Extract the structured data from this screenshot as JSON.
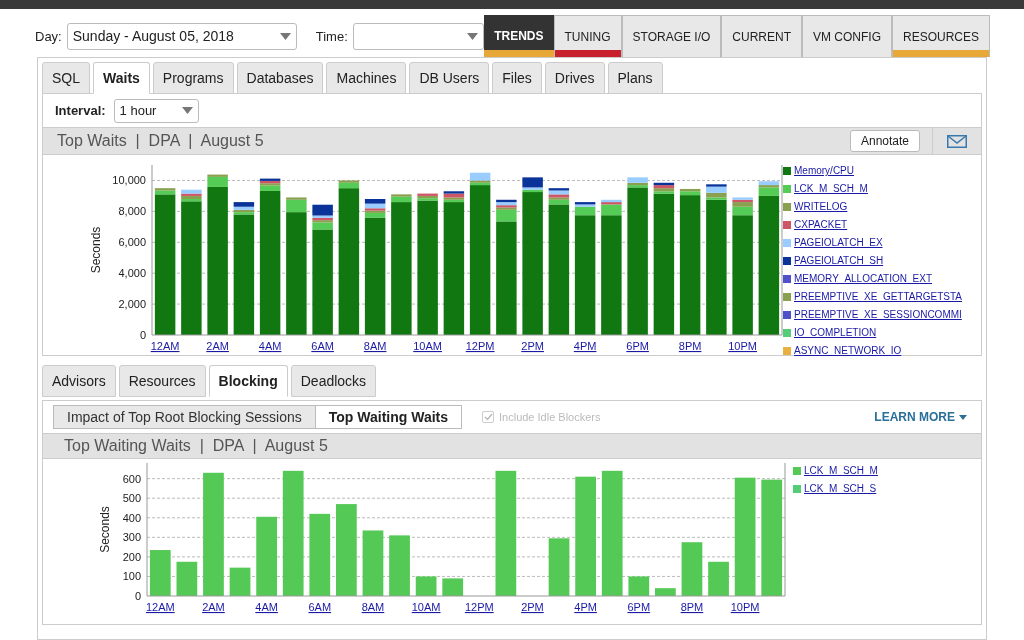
{
  "filters": {
    "day_label": "Day:",
    "day_value": "Sunday - August 05, 2018",
    "time_label": "Time:"
  },
  "nav_tabs": [
    {
      "label": "TRENDS",
      "selected": true,
      "color": "#e8a838"
    },
    {
      "label": "TUNING",
      "selected": false,
      "color": "#c8202c"
    },
    {
      "label": "STORAGE I/O",
      "selected": false
    },
    {
      "label": "CURRENT",
      "selected": false
    },
    {
      "label": "VM CONFIG",
      "selected": false
    },
    {
      "label": "RESOURCES",
      "selected": false,
      "color": "#e8a838"
    }
  ],
  "tabs": [
    {
      "label": "SQL",
      "selected": false
    },
    {
      "label": "Waits",
      "selected": true
    },
    {
      "label": "Programs",
      "selected": false
    },
    {
      "label": "Databases",
      "selected": false
    },
    {
      "label": "Machines",
      "selected": false
    },
    {
      "label": "DB Users",
      "selected": false
    },
    {
      "label": "Files",
      "selected": false
    },
    {
      "label": "Drives",
      "selected": false
    },
    {
      "label": "Plans",
      "selected": false
    }
  ],
  "waits_panel": {
    "interval_label": "Interval:",
    "interval_value": "1 hour",
    "header": "Top Waits  |  DPA  |  August 5",
    "annotate_button": "Annotate",
    "chart_data": {
      "type": "bar",
      "stacked": true,
      "grid": true,
      "ylabel": "Seconds",
      "ylim": [
        0,
        11000
      ],
      "yticks": [
        {
          "value": 0,
          "label": "0"
        },
        {
          "value": 2000,
          "label": "2,000"
        },
        {
          "value": 4000,
          "label": "4,000"
        },
        {
          "value": 6000,
          "label": "6,000"
        },
        {
          "value": 8000,
          "label": "8,000"
        },
        {
          "value": 10000,
          "label": "10,000"
        }
      ],
      "categories": [
        "12AM",
        null,
        "2AM",
        null,
        "4AM",
        null,
        "6AM",
        null,
        "8AM",
        null,
        "10AM",
        null,
        "12PM",
        null,
        "2PM",
        null,
        "4PM",
        null,
        "6PM",
        null,
        "8PM",
        null,
        "10PM",
        null
      ],
      "series": [
        {
          "name": "Memory/CPU",
          "color": "#117711",
          "values": [
            9100,
            8650,
            9580,
            7800,
            9320,
            7950,
            6830,
            9500,
            7600,
            8600,
            8700,
            8600,
            9700,
            7350,
            9250,
            8450,
            7750,
            7750,
            9550,
            9150,
            9050,
            8750,
            7750,
            9000
          ]
        },
        {
          "name": "LCK_M_SCH_M",
          "color": "#55cc55",
          "values": [
            250,
            150,
            650,
            150,
            350,
            800,
            450,
            350,
            300,
            350,
            150,
            150,
            150,
            750,
            150,
            300,
            550,
            700,
            150,
            150,
            250,
            150,
            550,
            550
          ]
        },
        {
          "name": "WRITELOG",
          "color": "#88a050",
          "values": [
            150,
            200,
            150,
            150,
            150,
            150,
            150,
            150,
            150,
            150,
            150,
            150,
            150,
            150,
            0,
            150,
            0,
            0,
            150,
            200,
            150,
            300,
            300,
            150
          ]
        },
        {
          "name": "CXPACKET",
          "color": "#cc5566",
          "values": [
            0,
            150,
            0,
            0,
            150,
            0,
            150,
            0,
            150,
            0,
            150,
            250,
            0,
            150,
            0,
            200,
            0,
            150,
            0,
            200,
            0,
            0,
            150,
            0
          ]
        },
        {
          "name": "PAGEIOLATCH_EX",
          "color": "#99ccff",
          "values": [
            0,
            250,
            0,
            200,
            0,
            0,
            150,
            0,
            300,
            0,
            0,
            0,
            500,
            200,
            150,
            250,
            150,
            150,
            350,
            0,
            0,
            400,
            150,
            250
          ]
        },
        {
          "name": "PAGEIOLATCH_SH",
          "color": "#0a3399",
          "values": [
            0,
            0,
            0,
            300,
            150,
            0,
            700,
            0,
            300,
            0,
            0,
            150,
            0,
            150,
            650,
            150,
            150,
            0,
            0,
            150,
            0,
            150,
            0,
            0
          ]
        },
        {
          "name": "MEMORY_ALLOCATION_EXT",
          "color": "#5050c8",
          "values": [
            0,
            0,
            0,
            0,
            0,
            0,
            0,
            0,
            0,
            0,
            0,
            0,
            0,
            0,
            0,
            0,
            0,
            0,
            0,
            0,
            0,
            0,
            0,
            0
          ]
        },
        {
          "name": "PREEMPTIVE_XE_GETTARGETSTA",
          "color": "#88a050",
          "values": [
            0,
            0,
            0,
            0,
            0,
            0,
            0,
            0,
            0,
            0,
            0,
            0,
            0,
            0,
            0,
            0,
            0,
            0,
            0,
            0,
            0,
            0,
            0,
            0
          ]
        },
        {
          "name": "PREEMPTIVE_XE_SESSIONCOMMI",
          "color": "#5050c8",
          "values": [
            0,
            0,
            0,
            0,
            0,
            0,
            0,
            0,
            0,
            0,
            0,
            0,
            0,
            0,
            0,
            0,
            0,
            0,
            0,
            0,
            0,
            0,
            0,
            0
          ]
        },
        {
          "name": "IO_COMPLETION",
          "color": "#55cc77",
          "values": [
            0,
            0,
            0,
            0,
            0,
            0,
            0,
            0,
            0,
            0,
            0,
            0,
            0,
            0,
            0,
            0,
            0,
            0,
            0,
            0,
            0,
            0,
            0,
            0
          ]
        },
        {
          "name": "ASYNC_NETWORK_IO",
          "color": "#e8b040",
          "values": [
            0,
            0,
            0,
            0,
            0,
            0,
            0,
            0,
            0,
            0,
            0,
            0,
            0,
            0,
            0,
            0,
            0,
            0,
            0,
            0,
            0,
            0,
            0,
            0
          ]
        }
      ]
    }
  },
  "sub_tabs": [
    {
      "label": "Advisors",
      "selected": false
    },
    {
      "label": "Resources",
      "selected": false
    },
    {
      "label": "Blocking",
      "selected": true
    },
    {
      "label": "Deadlocks",
      "selected": false
    }
  ],
  "blocking_panel": {
    "views": [
      {
        "label": "Impact of Top Root Blocking Sessions",
        "selected": false
      },
      {
        "label": "Top Waiting Waits",
        "selected": true
      }
    ],
    "include_idle": {
      "label": "Include Idle Blockers",
      "checked": true,
      "disabled": true
    },
    "learn_more": "LEARN MORE",
    "header": "Top Waiting Waits  |  DPA  |  August 5",
    "chart_data": {
      "type": "bar",
      "stacked": true,
      "grid": true,
      "ylabel": "Seconds",
      "ylim": [
        0,
        680
      ],
      "yticks": [
        {
          "value": 0,
          "label": "0"
        },
        {
          "value": 100,
          "label": "100"
        },
        {
          "value": 200,
          "label": "200"
        },
        {
          "value": 300,
          "label": "300"
        },
        {
          "value": 400,
          "label": "400"
        },
        {
          "value": 500,
          "label": "500"
        },
        {
          "value": 600,
          "label": "600"
        }
      ],
      "categories": [
        "12AM",
        null,
        "2AM",
        null,
        "4AM",
        null,
        "6AM",
        null,
        "8AM",
        null,
        "10AM",
        null,
        "12PM",
        null,
        "2PM",
        null,
        "4PM",
        null,
        "6PM",
        null,
        "8PM",
        null,
        "10PM",
        null
      ],
      "series": [
        {
          "name": "LCK_M_SCH_M",
          "color": "#55c955",
          "values": [
            235,
            175,
            630,
            145,
            405,
            640,
            420,
            470,
            335,
            310,
            100,
            90,
            0,
            640,
            0,
            295,
            610,
            640,
            100,
            40,
            275,
            175,
            605,
            595
          ]
        },
        {
          "name": "LCK_M_SCH_S",
          "color": "#55cc77",
          "values": [
            0,
            0,
            0,
            0,
            0,
            0,
            0,
            0,
            0,
            0,
            0,
            0,
            0,
            0,
            0,
            0,
            0,
            0,
            0,
            0,
            0,
            0,
            0,
            0
          ]
        }
      ]
    }
  }
}
